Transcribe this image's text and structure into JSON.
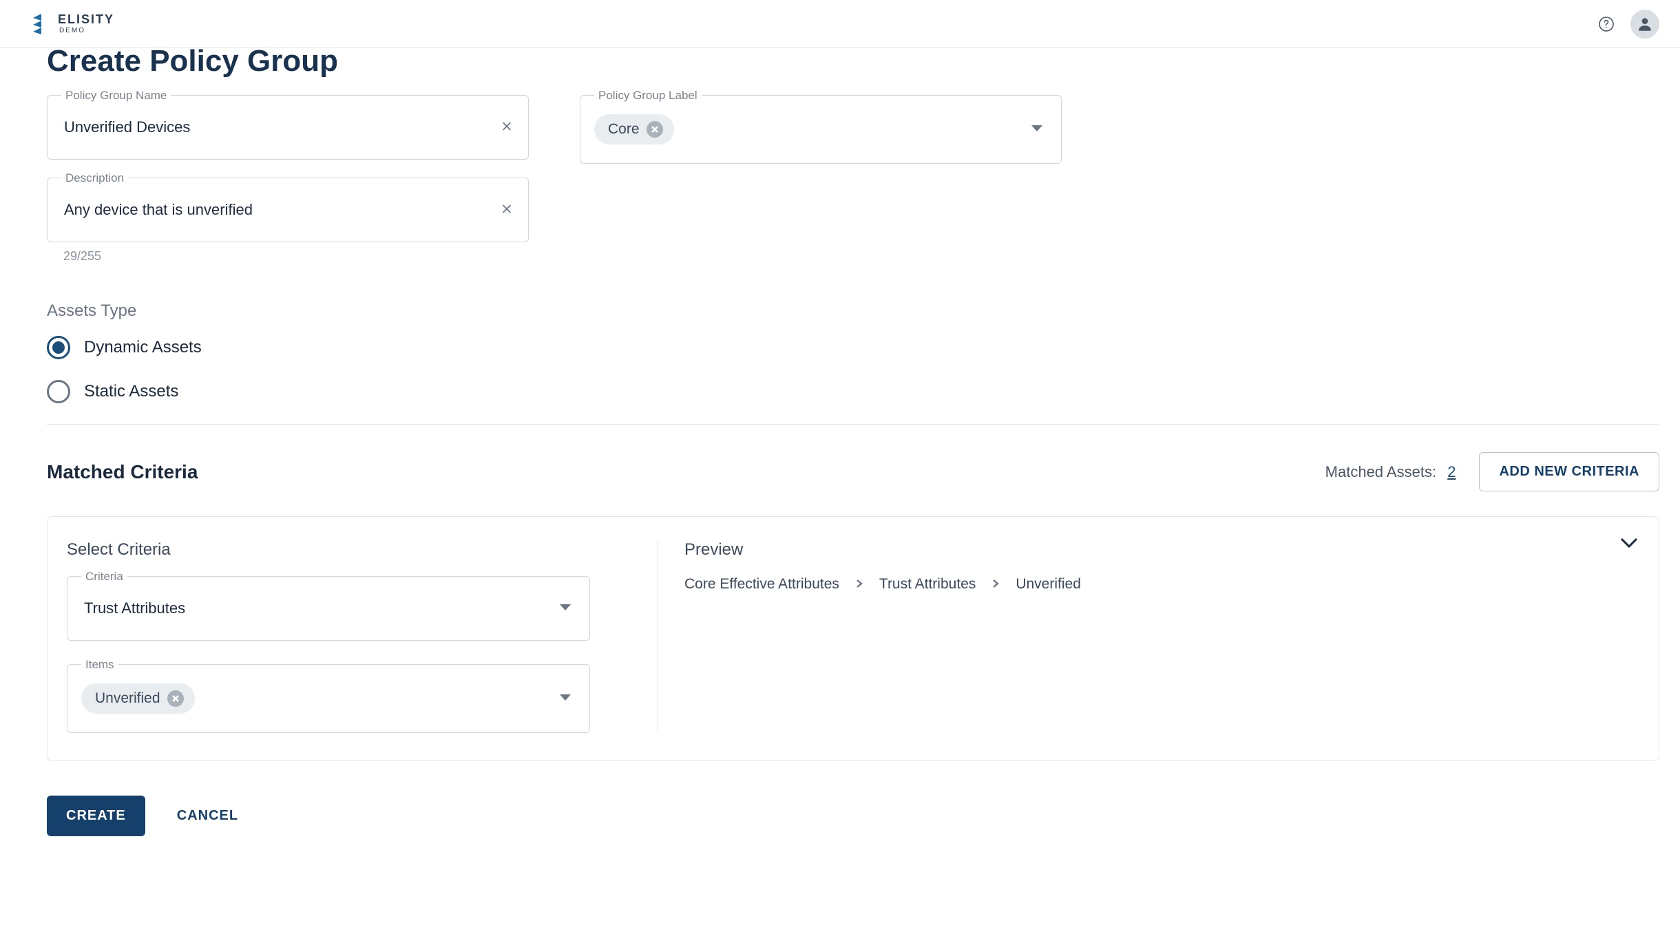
{
  "header": {
    "brand_name": "ELISITY",
    "brand_sub": "DEMO"
  },
  "page": {
    "title": "Create Policy Group",
    "fields": {
      "name": {
        "label": "Policy Group Name",
        "value": "Unverified Devices"
      },
      "label": {
        "label": "Policy Group Label",
        "chip": "Core"
      },
      "description": {
        "label": "Description",
        "value": "Any device that is unverified",
        "counter": "29/255"
      }
    },
    "assets": {
      "section": "Assets Type",
      "dynamic": "Dynamic Assets",
      "static": "Static Assets"
    },
    "matched": {
      "title": "Matched Criteria",
      "count_label": "Matched Assets:",
      "count": "2",
      "add_btn": "ADD NEW CRITERIA",
      "criteria": {
        "select_title": "Select Criteria",
        "criteria_label": "Criteria",
        "criteria_value": "Trust Attributes",
        "items_label": "Items",
        "items_chip": "Unverified",
        "preview_title": "Preview",
        "crumbs": [
          "Core Effective Attributes",
          "Trust Attributes",
          "Unverified"
        ]
      }
    },
    "actions": {
      "create": "CREATE",
      "cancel": "CANCEL"
    }
  }
}
